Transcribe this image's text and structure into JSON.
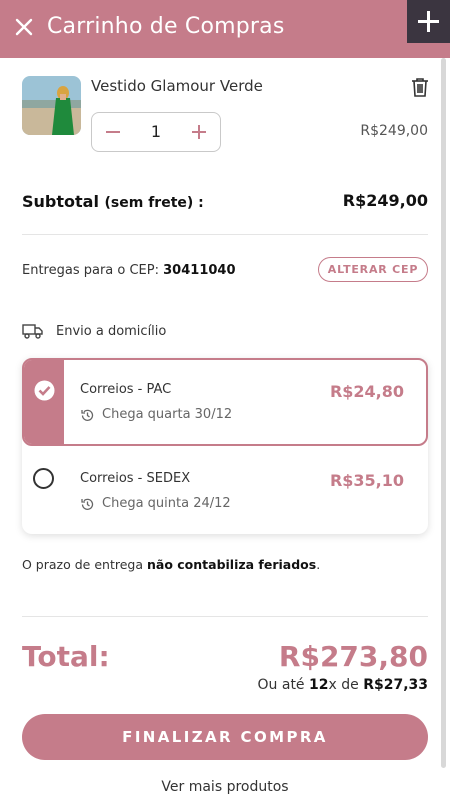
{
  "header": {
    "close_icon": "close-icon",
    "title": "Carrinho de Compras",
    "corner_icon": "plus-icon",
    "color": "#c57c8a"
  },
  "cart": {
    "items": [
      {
        "name": "Vestido Glamour Verde",
        "quantity": "1",
        "price": "R$249,00",
        "image_icon": "product-photo",
        "delete_icon": "trash-icon"
      }
    ],
    "subtotal_label": "Subtotal",
    "subtotal_note": "(sem frete) :",
    "subtotal_value": "R$249,00"
  },
  "shipping": {
    "cep_label": "Entregas para o CEP:",
    "cep_value": "30411040",
    "change_cep_label": "ALTERAR CEP",
    "method_label": "Envio a domicílio",
    "options": [
      {
        "name": "Correios - PAC",
        "arrival": "Chega quarta 30/12",
        "price": "R$24,80",
        "selected": true
      },
      {
        "name": "Correios - SEDEX",
        "arrival": "Chega quinta 24/12",
        "price": "R$35,10",
        "selected": false
      }
    ],
    "note_prefix": "O prazo de entrega",
    "note_bold": "não contabiliza feriados",
    "note_suffix": "."
  },
  "summary": {
    "total_label": "Total:",
    "total_value": "R$273,80",
    "install_prefix": "Ou até",
    "install_count": "12",
    "install_mid": "x de",
    "install_value": "R$27,33"
  },
  "actions": {
    "checkout_label": "FINALIZAR COMPRA",
    "more_products_label": "Ver mais produtos"
  },
  "colors": {
    "accent": "#c57c8a",
    "corner": "#3b3540"
  }
}
